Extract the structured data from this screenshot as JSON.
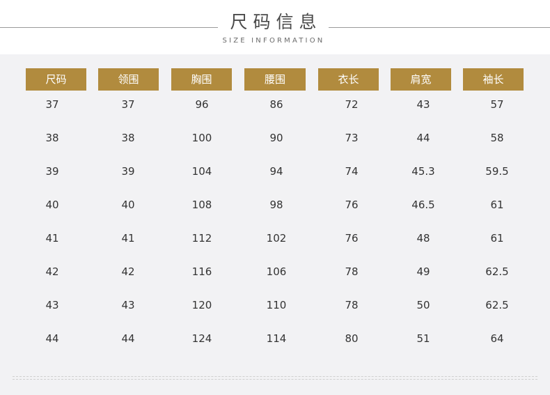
{
  "header": {
    "title": "尺码信息",
    "subtitle": "SIZE INFORMATION"
  },
  "accent_color": "#b18b3e",
  "panel_color": "#f2f2f4",
  "table": {
    "columns": [
      "尺码",
      "领围",
      "胸围",
      "腰围",
      "衣长",
      "肩宽",
      "袖长"
    ],
    "rows": [
      [
        "37",
        "37",
        "96",
        "86",
        "72",
        "43",
        "57"
      ],
      [
        "38",
        "38",
        "100",
        "90",
        "73",
        "44",
        "58"
      ],
      [
        "39",
        "39",
        "104",
        "94",
        "74",
        "45.3",
        "59.5"
      ],
      [
        "40",
        "40",
        "108",
        "98",
        "76",
        "46.5",
        "61"
      ],
      [
        "41",
        "41",
        "112",
        "102",
        "76",
        "48",
        "61"
      ],
      [
        "42",
        "42",
        "116",
        "106",
        "78",
        "49",
        "62.5"
      ],
      [
        "43",
        "43",
        "120",
        "110",
        "78",
        "50",
        "62.5"
      ],
      [
        "44",
        "44",
        "124",
        "114",
        "80",
        "51",
        "64"
      ]
    ]
  }
}
